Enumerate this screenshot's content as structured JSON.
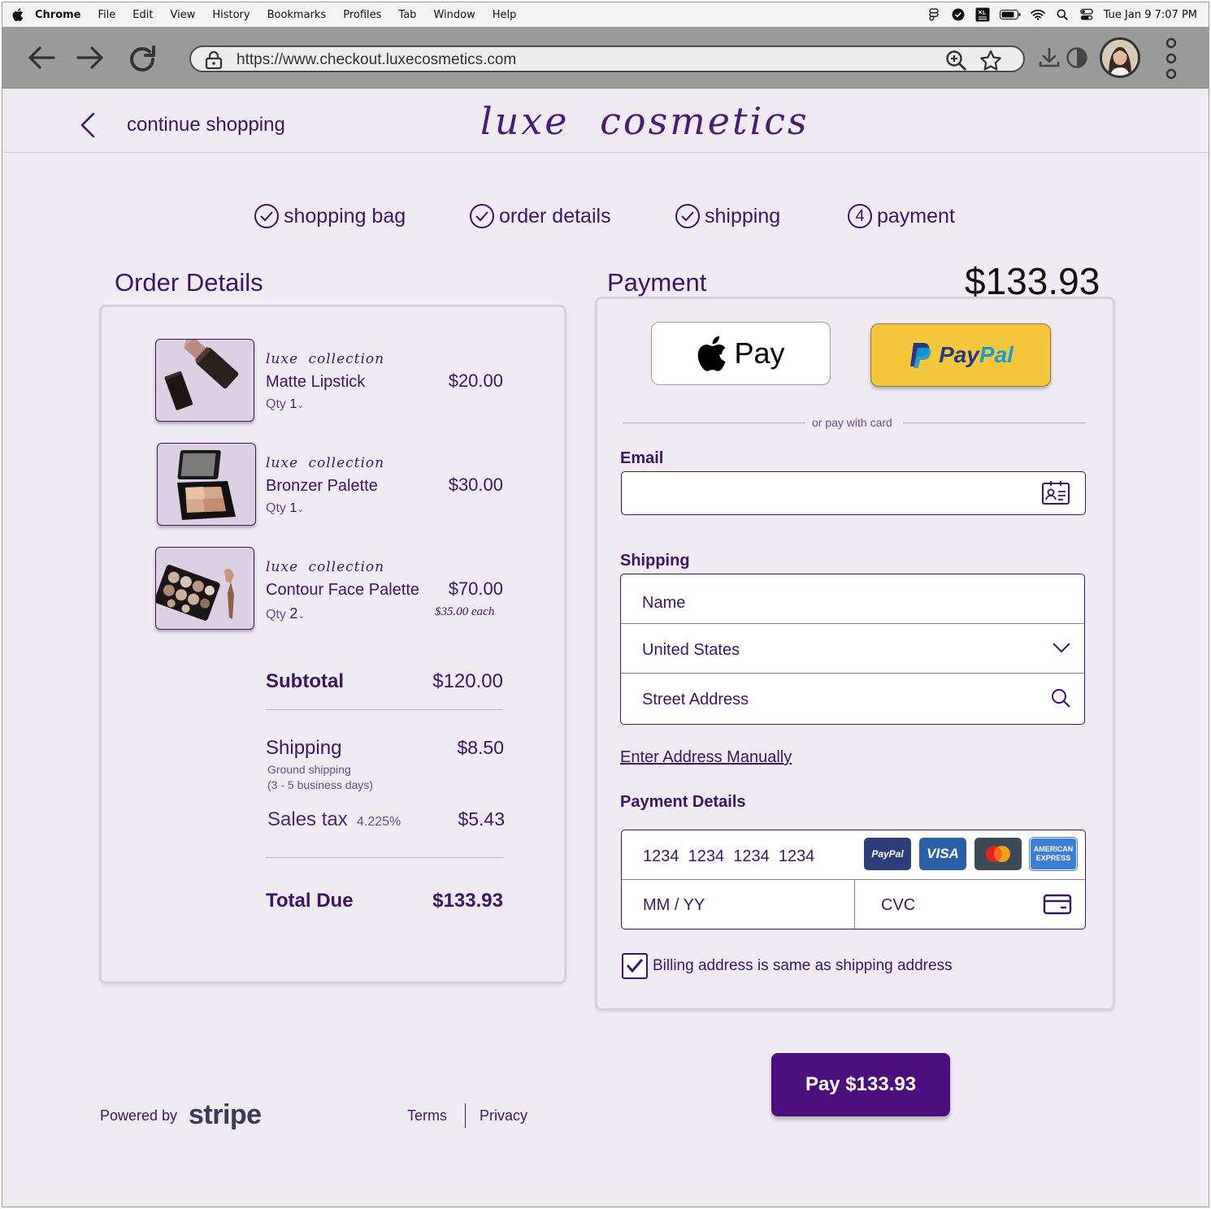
{
  "menubar": {
    "app": "Chrome",
    "items": [
      "File",
      "Edit",
      "View",
      "History",
      "Bookmarks",
      "Profiles",
      "Tab",
      "Window",
      "Help"
    ],
    "clock": "Tue Jan 9  7:07 PM"
  },
  "browser": {
    "url": "https://www.checkout.luxecosmetics.com"
  },
  "header": {
    "continue_label": "continue shopping",
    "logo": "luxe cosmetics"
  },
  "steps": [
    {
      "label": "shopping bag",
      "state": "done"
    },
    {
      "label": "order details",
      "state": "done"
    },
    {
      "label": "shipping",
      "state": "done"
    },
    {
      "label": "payment",
      "number": "4",
      "state": "current"
    }
  ],
  "order": {
    "title": "Order Details",
    "items": [
      {
        "collection": "luxe collection",
        "name": "Matte Lipstick",
        "qty_label": "Qty",
        "qty": "1",
        "price": "$20.00",
        "icon": "lipstick-image"
      },
      {
        "collection": "luxe collection",
        "name": "Bronzer Palette",
        "qty_label": "Qty",
        "qty": "1",
        "price": "$30.00",
        "icon": "bronzer-palette-image"
      },
      {
        "collection": "luxe collection",
        "name": "Contour Face Palette",
        "qty_label": "Qty",
        "qty": "2",
        "price": "$70.00",
        "each": "$35.00 each",
        "icon": "contour-palette-image"
      }
    ],
    "subtotal_label": "Subtotal",
    "subtotal": "$120.00",
    "shipping_label": "Shipping",
    "shipping": "$8.50",
    "shipping_method": "Ground shipping",
    "shipping_time": "(3 - 5 business days)",
    "tax_label": "Sales tax",
    "tax_rate": "4.225%",
    "tax": "$5.43",
    "total_label": "Total Due",
    "total": "$133.93"
  },
  "payment": {
    "title": "Payment",
    "amount": "$133.93",
    "apple_pay_label": "Pay",
    "paypal_label_a": "Pay",
    "paypal_label_b": "Pal",
    "or_text": "or pay with card",
    "email_label": "Email",
    "email_value": "",
    "shipping_label": "Shipping",
    "name_placeholder": "Name",
    "country": "United States",
    "street_placeholder": "Street Address",
    "manual_link": "Enter Address Manually",
    "details_label": "Payment Details",
    "card_placeholder": "1234  1234  1234  1234",
    "expiry_placeholder": "MM / YY",
    "cvc_placeholder": "CVC",
    "brands": {
      "paypal": "PayPal",
      "visa": "VISA",
      "amex_line1": "AMERICAN",
      "amex_line2": "EXPRESS"
    },
    "billing_same_label": "Billing address is same as shipping address",
    "billing_same_checked": true,
    "pay_button": "Pay $133.93"
  },
  "footer": {
    "powered_by": "Powered by",
    "brand": "stripe",
    "terms": "Terms",
    "privacy": "Privacy"
  },
  "colors": {
    "accent": "#3d1466",
    "pay_button": "#4b0f7d",
    "paypal_yellow": "#f5c73d",
    "background": "#f0ebf3"
  }
}
